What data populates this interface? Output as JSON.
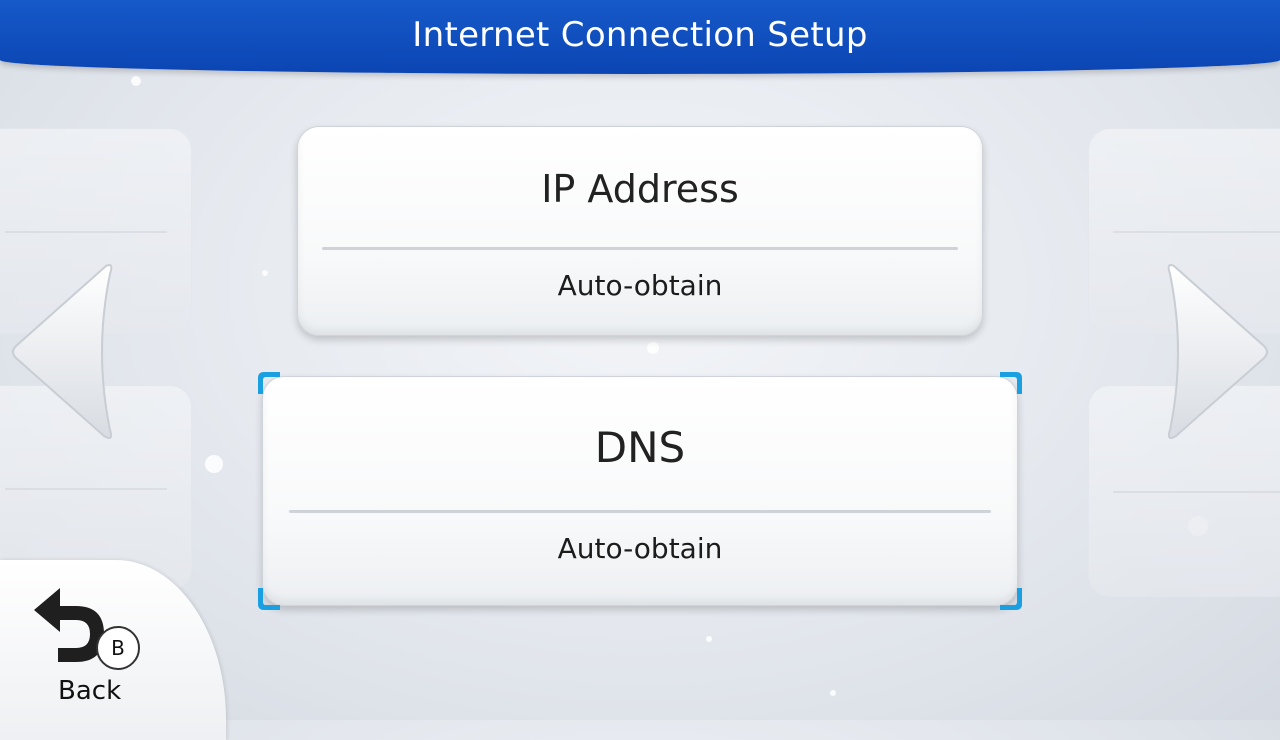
{
  "header": {
    "title": "Internet Connection Setup"
  },
  "settings": [
    {
      "label": "IP Address",
      "value": "Auto-obtain",
      "selected": false
    },
    {
      "label": "DNS",
      "value": "Auto-obtain",
      "selected": true
    }
  ],
  "navigation": {
    "prev_icon": "chevron-left-icon",
    "next_icon": "chevron-right-icon"
  },
  "back": {
    "label": "Back",
    "button_glyph": "B",
    "icon": "back-arrow-icon"
  },
  "colors": {
    "header": "#0b45b3",
    "selection_corner": "#1aa0e0",
    "card": "#ffffff"
  }
}
